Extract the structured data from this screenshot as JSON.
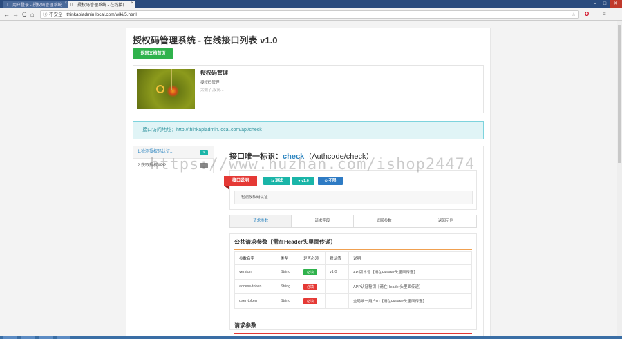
{
  "browser": {
    "tabs": [
      {
        "label": "用户登录 - 授权码管理系统"
      },
      {
        "label": "授权码管理系统 - 在线接口"
      }
    ],
    "url": "thinkapiadmin.local.com/wiki/5.html",
    "security_label": "不安全",
    "nav": {
      "back": "←",
      "forward": "→",
      "reload": "C",
      "home": "⌂"
    },
    "window_controls": {
      "minimize": "–",
      "maximize": "□",
      "close": "✕"
    },
    "tab_icon": "▯",
    "tab_close": "×",
    "bookmark_icon": "☆",
    "opera_icon": "O",
    "menu_icon": "≡",
    "info_icon": "ⓘ"
  },
  "page": {
    "title": "授权码管理系统 - 在线接口列表 v1.0",
    "home_button": "返回文档首页",
    "app_card": {
      "name": "授权码管理",
      "subtitle": "授权码管理",
      "more": "太懒了,没简..."
    },
    "api_address": "接口访问地址：http://thinkapiadmin.local.com/api/check",
    "sidebar": [
      {
        "label": "1.检测授权码认证...",
        "badge": ">"
      },
      {
        "label": "2.获取授权APP",
        "badge": "..."
      }
    ],
    "api": {
      "title_prefix": "接口唯一标识：",
      "code": "check",
      "path": "（Authcode/check）",
      "ribbon": "接口说明",
      "tags": [
        "⇆ 测试",
        "● v1.0",
        "⊘ 不限"
      ],
      "description": "检测授权码认证"
    },
    "tabs": [
      "请求参数",
      "请求字段",
      "返回参数",
      "返回示例"
    ],
    "public_params": {
      "title": "公共请求参数【需在Header头里面传递】",
      "headers": [
        "参数名字",
        "类型",
        "是否必须",
        "默认值",
        "说明"
      ],
      "rows": [
        {
          "name": "version",
          "type": "String",
          "required": "必填",
          "default": "v1.0",
          "desc": "API版本号【请在Header头里面传递】"
        },
        {
          "name": "access-token",
          "type": "String",
          "required": "必填",
          "default": "",
          "desc": "APP认证秘钥【请在Header头里面传递】"
        },
        {
          "name": "user-token",
          "type": "String",
          "required": "必填",
          "default": "",
          "desc": "全局唯一用户ID【请在Header头里面传递】"
        }
      ]
    },
    "request_params": {
      "title": "请求参数"
    }
  },
  "watermark": "https://www.huzhan.com/ishop24474",
  "colors": {
    "primary": "#2e86c1",
    "success": "#2fb24c",
    "danger": "#e53935",
    "teal": "#1ab5a8",
    "info_bg": "#e0f4f6"
  }
}
